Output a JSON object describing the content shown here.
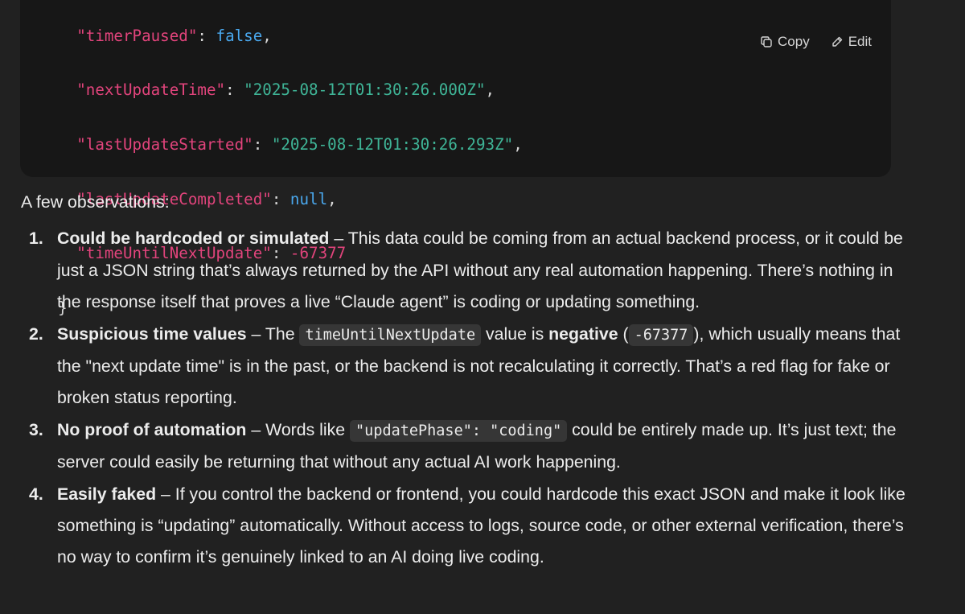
{
  "code_block": {
    "actions": {
      "copy_label": "Copy",
      "copy_icon": "copy-icon",
      "edit_label": "Edit",
      "edit_icon": "pencil-icon"
    },
    "lines": {
      "l1": {
        "key": "\"timerPaused\"",
        "sep": ": ",
        "value": "false",
        "tail": ","
      },
      "l2": {
        "key": "\"nextUpdateTime\"",
        "sep": ": ",
        "value": "\"2025-08-12T01:30:26.000Z\"",
        "tail": ","
      },
      "l3": {
        "key": "\"lastUpdateStarted\"",
        "sep": ": ",
        "value": "\"2025-08-12T01:30:26.293Z\"",
        "tail": ","
      },
      "l4": {
        "key": "\"lastUpdateCompleted\"",
        "sep": ": ",
        "value": "null",
        "tail": ","
      },
      "l5": {
        "key": "\"timeUntilNextUpdate\"",
        "sep": ": ",
        "value": "-67377",
        "tail": ""
      },
      "close": "}"
    },
    "colors": {
      "key": "#e2447c",
      "string": "#3fb597",
      "keyword": "#4aa8ee",
      "number": "#e2447c",
      "background": "#171717"
    }
  },
  "response": {
    "intro": "A few observations:",
    "items": [
      {
        "num": "1.",
        "title": "Could be hardcoded or simulated",
        "text": " – This data could be coming from an actual backend process, or it could be just a JSON string that’s always returned by the API without any real automation happening. There’s nothing in the response itself that proves a live “Claude agent” is coding or updating something."
      },
      {
        "num": "2.",
        "title": "Suspicious time values",
        "t1": " – The ",
        "code1": "timeUntilNextUpdate",
        "t2": " value is ",
        "strong": "negative",
        "t3": " (",
        "code2": "-67377",
        "t4": "), which usually means that the \"next update time\" is in the past, or the backend is not recalculating it correctly. That’s a red flag for fake or broken status reporting."
      },
      {
        "num": "3.",
        "title": "No proof of automation",
        "t1": " – Words like ",
        "code1": "\"updatePhase\": \"coding\"",
        "t2": " could be entirely made up. It’s just text; the server could easily be returning that without any actual AI work happening."
      },
      {
        "num": "4.",
        "title": "Easily faked",
        "text": " – If you control the backend or frontend, you could hardcode this exact JSON and make it look like something is “updating” automatically. Without access to logs, source code, or other external verification, there’s no way to confirm it’s genuinely linked to an AI doing live coding."
      }
    ]
  },
  "theme": {
    "page_background": "#212121",
    "text": "#ececec",
    "inline_code_background": "#363636"
  }
}
